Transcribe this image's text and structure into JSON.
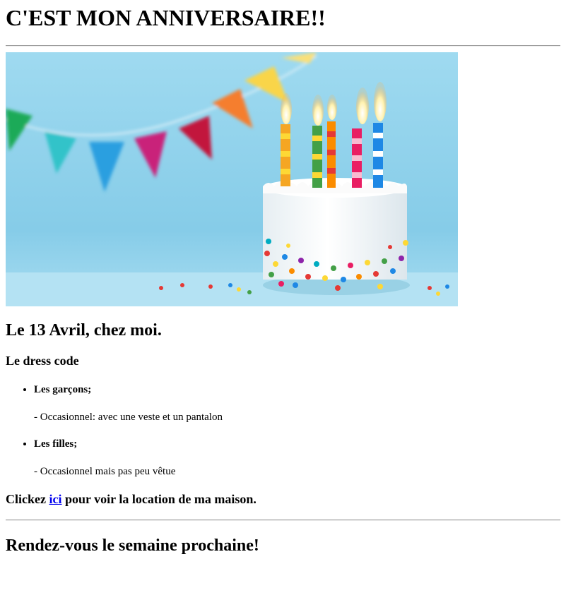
{
  "header": {
    "title": "C'EST MON ANNIVERSAIRE!!"
  },
  "photo": {
    "alt": "Gâteau d'anniversaire avec bougies"
  },
  "event": {
    "date_place": "Le 13 Avril, chez moi."
  },
  "dress_code": {
    "heading": "Le dress code",
    "groups": [
      {
        "label": "Les garçons;",
        "note": "- Occasionnel: avec une veste et un pantalon"
      },
      {
        "label": "Les filles;",
        "note": "- Occasionnel mais pas peu vêtue"
      }
    ]
  },
  "location": {
    "prefix": "Clickez ",
    "link_label": "ici",
    "suffix": " pour voir la location de ma maison."
  },
  "footer": {
    "message": "Rendez-vous le semaine prochaine!"
  },
  "colors": {
    "link": "#0000ee",
    "sky": "#8fd0ea"
  }
}
